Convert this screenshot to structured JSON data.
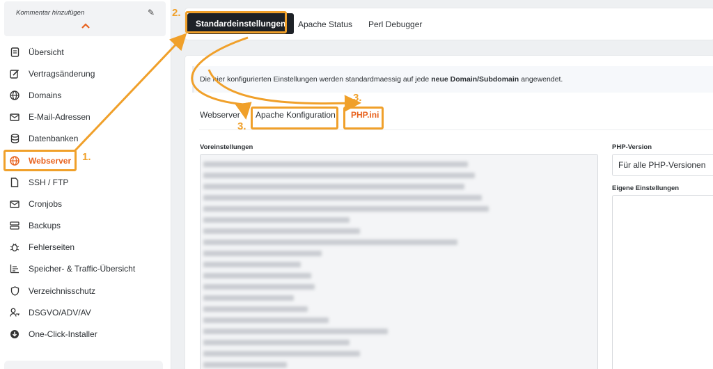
{
  "sidebar": {
    "comment_label": "Kommentar hinzufügen",
    "items": [
      {
        "label": "Übersicht",
        "icon": "document-icon"
      },
      {
        "label": "Vertragsänderung",
        "icon": "edit-icon"
      },
      {
        "label": "Domains",
        "icon": "globe-icon"
      },
      {
        "label": "E-Mail-Adressen",
        "icon": "mail-icon"
      },
      {
        "label": "Datenbanken",
        "icon": "database-icon"
      },
      {
        "label": "Webserver",
        "icon": "server-globe-icon",
        "active": true
      },
      {
        "label": "SSH / FTP",
        "icon": "file-icon"
      },
      {
        "label": "Cronjobs",
        "icon": "clock-mail-icon"
      },
      {
        "label": "Backups",
        "icon": "backup-icon"
      },
      {
        "label": "Fehlerseiten",
        "icon": "bug-icon"
      },
      {
        "label": "Speicher- & Traffic-Übersicht",
        "icon": "chart-icon"
      },
      {
        "label": "Verzeichnisschutz",
        "icon": "shield-icon"
      },
      {
        "label": "DSGVO/ADV/AV",
        "icon": "user-key-icon"
      },
      {
        "label": "One-Click-Installer",
        "icon": "download-icon"
      }
    ]
  },
  "top_tabs": {
    "standard": "Standardeinstellungen",
    "apache_status": "Apache Status",
    "perl": "Perl Debugger"
  },
  "info": {
    "prefix": "Die hier konfigurierten Einstellungen werden standardmaessig auf jede",
    "bold": "neue Domain/Subdomain",
    "suffix": "angewendet."
  },
  "sub_tabs": {
    "webserver": "Webserver",
    "apache_konfig": "Apache Konfiguration",
    "phpini": "PHP.ini"
  },
  "form": {
    "voreinstellungen_label": "Voreinstellungen",
    "php_version_label": "PHP-Version",
    "php_version_value": "Für alle PHP-Versionen",
    "eigene_label": "Eigene Einstellungen"
  },
  "annotations": {
    "n1": "1.",
    "n2": "2.",
    "n3a": "3.",
    "n3b": "3."
  },
  "colors": {
    "accent": "#e8621e",
    "annotation": "#f0a02a",
    "dark_tab": "#1d2126"
  }
}
